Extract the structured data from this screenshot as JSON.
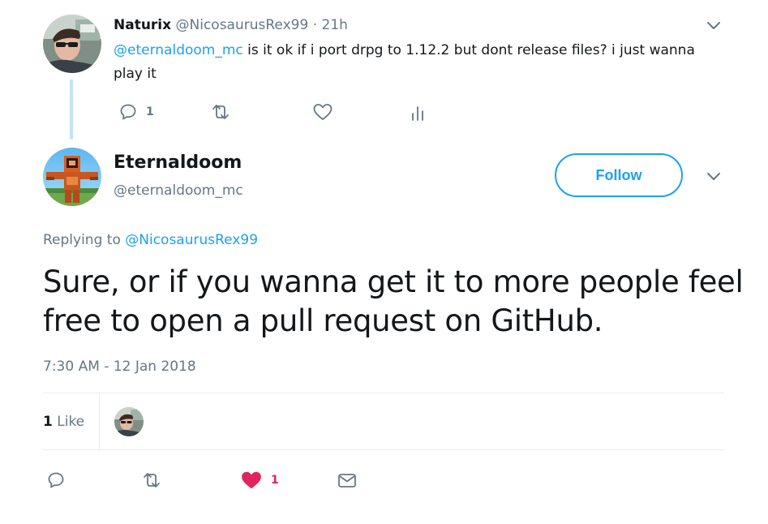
{
  "parent_tweet": {
    "name": "Naturix",
    "handle": "@NicosaurusRex99",
    "separator": "·",
    "time": "21h",
    "mention": "@eternaldoom_mc",
    "text": " is it ok if i port drpg to 1.12.2 but dont release files? i just wanna play it",
    "reply_count": "1"
  },
  "main_tweet": {
    "name": "Eternaldoom",
    "handle": "@eternaldoom_mc",
    "follow_label": "Follow",
    "replying_prefix": "Replying to ",
    "replying_to": "@NicosaurusRex99",
    "text": "Sure, or if you wanna get it to more people feel free to open a pull request on GitHub.",
    "timestamp": "7:30 AM - 12 Jan 2018",
    "likes_number": "1",
    "likes_label": "Like",
    "like_count": "1"
  },
  "icons": {
    "reply": "reply-icon",
    "retweet": "retweet-icon",
    "like": "heart-icon",
    "analytics": "analytics-icon",
    "dm": "envelope-icon",
    "caret": "chevron-down-icon"
  },
  "colors": {
    "accent": "#1da1f2",
    "text": "#14171a",
    "muted": "#657786",
    "like": "#e0245e",
    "thread_line": "#c4e3f5"
  }
}
